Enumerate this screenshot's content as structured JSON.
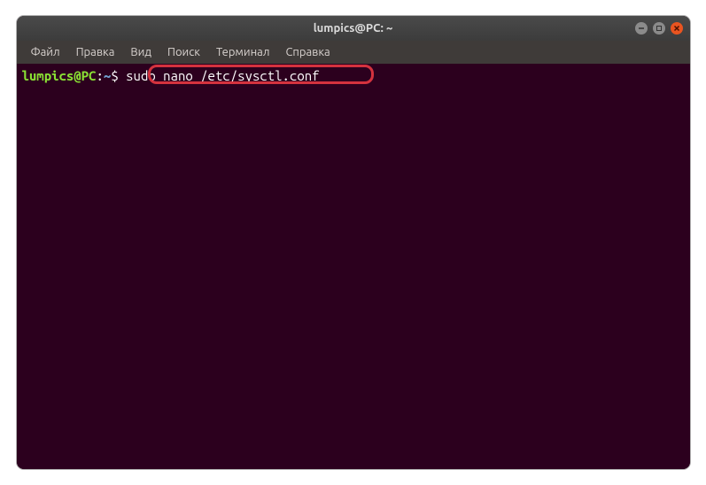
{
  "window": {
    "title": "lumpics@PC: ~"
  },
  "menubar": {
    "file": "Файл",
    "edit": "Правка",
    "view": "Вид",
    "search": "Поиск",
    "terminal": "Терминал",
    "help": "Справка"
  },
  "terminal": {
    "prompt_user": "lumpics@PC",
    "prompt_colon": ":",
    "prompt_path": "~",
    "prompt_dollar": "$ ",
    "command": "sudo nano /etc/sysctl.conf"
  },
  "colors": {
    "terminal_bg": "#2c001e",
    "prompt_green": "#8ae234",
    "prompt_blue": "#729fcf",
    "text_white": "#ffffff",
    "highlight_red": "#d4323e",
    "close_orange": "#e95420"
  }
}
